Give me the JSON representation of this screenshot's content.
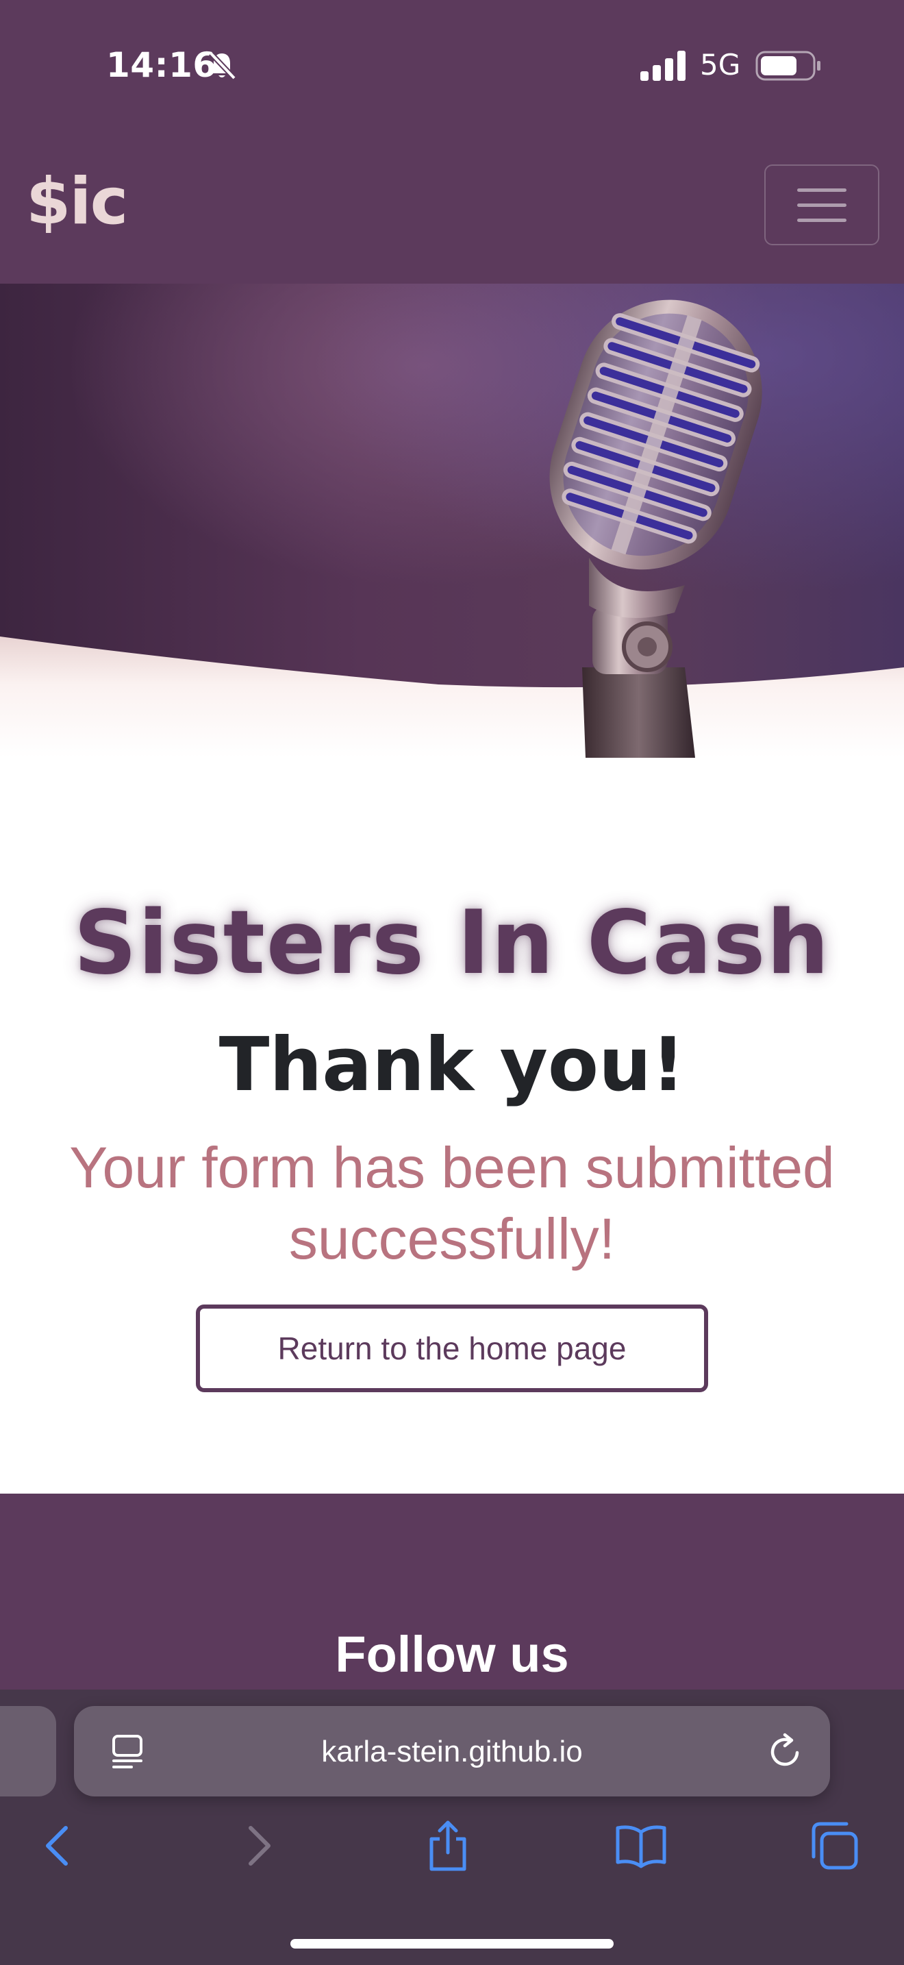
{
  "status_bar": {
    "time": "14:16",
    "network": "5G",
    "icons": [
      "bell-slash-icon",
      "signal-icon",
      "battery-icon"
    ]
  },
  "navbar": {
    "brand": "$ic",
    "menu_icon": "hamburger-icon"
  },
  "hero": {
    "image": "vintage-microphone-photo"
  },
  "main": {
    "site_title": "Sisters In Cash",
    "heading": "Thank you!",
    "message": "Your form has been submitted successfully!",
    "home_button_label": "Return to the home page"
  },
  "footer": {
    "follow_title": "Follow us"
  },
  "browser": {
    "url": "karla-stein.github.io",
    "icons": [
      "reader-icon",
      "reload-icon",
      "back-icon",
      "forward-icon",
      "share-icon",
      "bookmarks-icon",
      "tabs-icon"
    ]
  },
  "colors": {
    "brand_purple": "#5c3a5c",
    "brand_text": "#ead7d7",
    "message_rose": "#b8737f",
    "toolbar_bg": "#46374a",
    "accent_blue": "#4a8ef5"
  }
}
